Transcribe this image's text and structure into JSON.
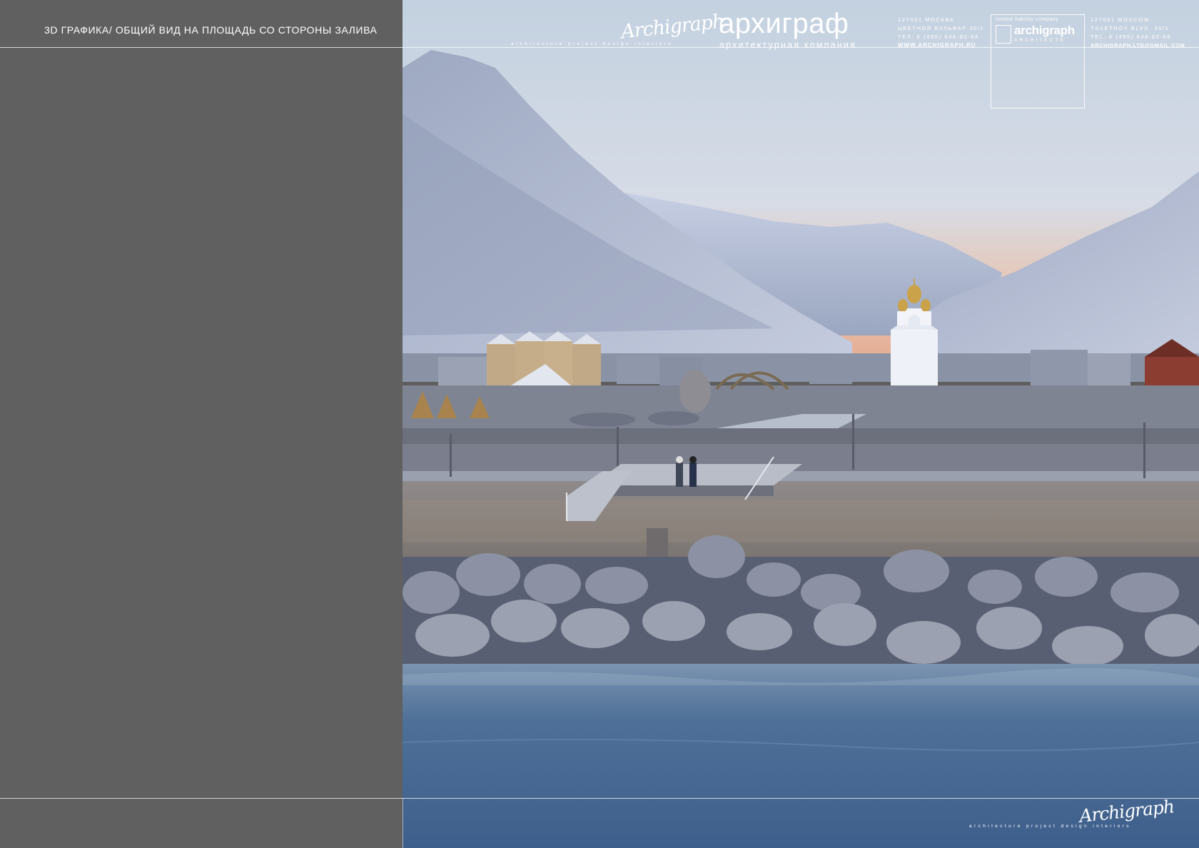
{
  "sheet": {
    "title": "3D  ГРАФИКА/ ОБЩИЙ ВИД НА ПЛОЩАДЬ СО СТОРОНЫ ЗАЛИВА"
  },
  "header": {
    "signature": "Archigraph",
    "signature_sub": "architecture  project  design  interiors",
    "brand_ru": "архиграф",
    "brand_ru_sub": "архитектурная компания",
    "address_ru": [
      "127051 МОСКВА",
      "ЦВЕТНОЙ БУЛЬВАР 30/1",
      "ТЕЛ: 8 (495) 648-80-68",
      "WWW.ARCHIGRAPH.RU"
    ],
    "box_logo": {
      "ltd": "limited liability company",
      "name": "archigraph",
      "sub": "ARCHITECTS"
    },
    "address_en": [
      "127051 MOSCOW",
      "TSVETNOY BLVD. 30/1",
      "TEL: 8 (495) 648-80-68",
      "ARCHIGRAPH.LTD@GMAIL.COM"
    ]
  },
  "footer": {
    "signature": "Archigraph",
    "signature_sub": "architecture  project  design  interiors"
  },
  "colors": {
    "panel": "#606060",
    "sky_top": "#c9d6e4",
    "sky_glow": "#e8b9a3",
    "mountain": "#a9b3c9",
    "water": "#4d6e94",
    "dome_gold": "#c9a24a"
  }
}
